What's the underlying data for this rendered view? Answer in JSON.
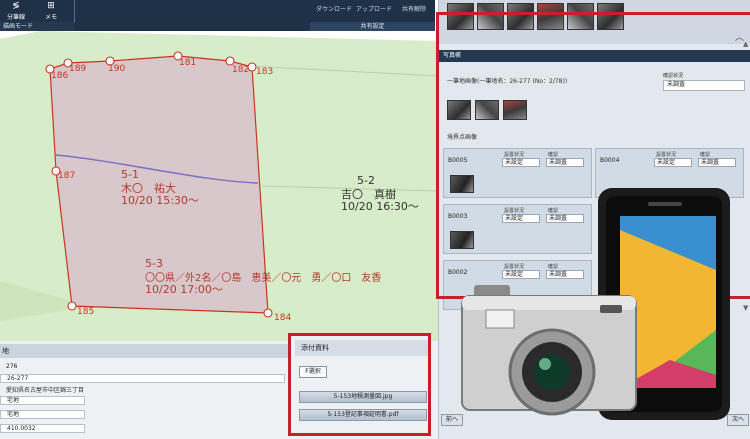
{
  "toolbar": {
    "btn1_label": "分筆線",
    "btn2_label": "メモ",
    "mode_label": "描画モード",
    "download_label": "ダウンロード",
    "upload_label": "アップロード",
    "share_link_label": "共有解除",
    "share_label": "共有設定"
  },
  "map": {
    "points": [
      "186",
      "189",
      "190",
      "181",
      "182",
      "183",
      "187",
      "184",
      "185"
    ],
    "parcel1": {
      "code": "5-1",
      "name": "木〇　祐大",
      "time": "10/20 15:30〜"
    },
    "parcel2": {
      "code": "5-2",
      "name": "吉〇　真樹",
      "time": "10/20 16:30〜"
    },
    "parcel3": {
      "code": "5-3",
      "name": "〇〇県／外2名／〇島　恵美／〇元　勇／〇口　友香",
      "time": "10/20 17:00〜"
    }
  },
  "form": {
    "header": "地",
    "row1": "276",
    "row2": "26-277",
    "address": "愛知県名古屋市中区錦三丁目",
    "row4": "宅地",
    "row5": "宅地",
    "row6": "410.0032"
  },
  "attr": {
    "title": "添付資料",
    "select_label": "F選択",
    "file1": "5-153地積測量図.jpg",
    "file2": "5-153登記事項証明書.pdf"
  },
  "photo_panel": {
    "band": "写真帳",
    "info_left": "一筆地画像(一筆地名：26-277 (No：2/78))",
    "info_right_label": "確認状況",
    "info_right_value": "未調査",
    "section_label": "境界点画像",
    "cards": [
      {
        "id": "B0005",
        "label_a": "設置状況",
        "label_b": "確認",
        "value_a": "未設定",
        "value_b": "未調査"
      },
      {
        "id": "B0004",
        "label_a": "設置状況",
        "label_b": "確認",
        "value_a": "未設定",
        "value_b": "未調査"
      },
      {
        "id": "B0003",
        "label_a": "設置状況",
        "label_b": "確認",
        "value_a": "未設定",
        "value_b": "未調査"
      },
      {
        "id": "B0002",
        "label_a": "設置状況",
        "label_b": "確認",
        "value_a": "未設定",
        "value_b": "未調査"
      }
    ],
    "prev_label": "前へ",
    "next_label": "次へ"
  },
  "colors": {
    "accent_red": "#c8202a",
    "navy": "#1f3147",
    "parcel_fill": "#d9c8cb",
    "land_fill": "#d7ecc8"
  }
}
